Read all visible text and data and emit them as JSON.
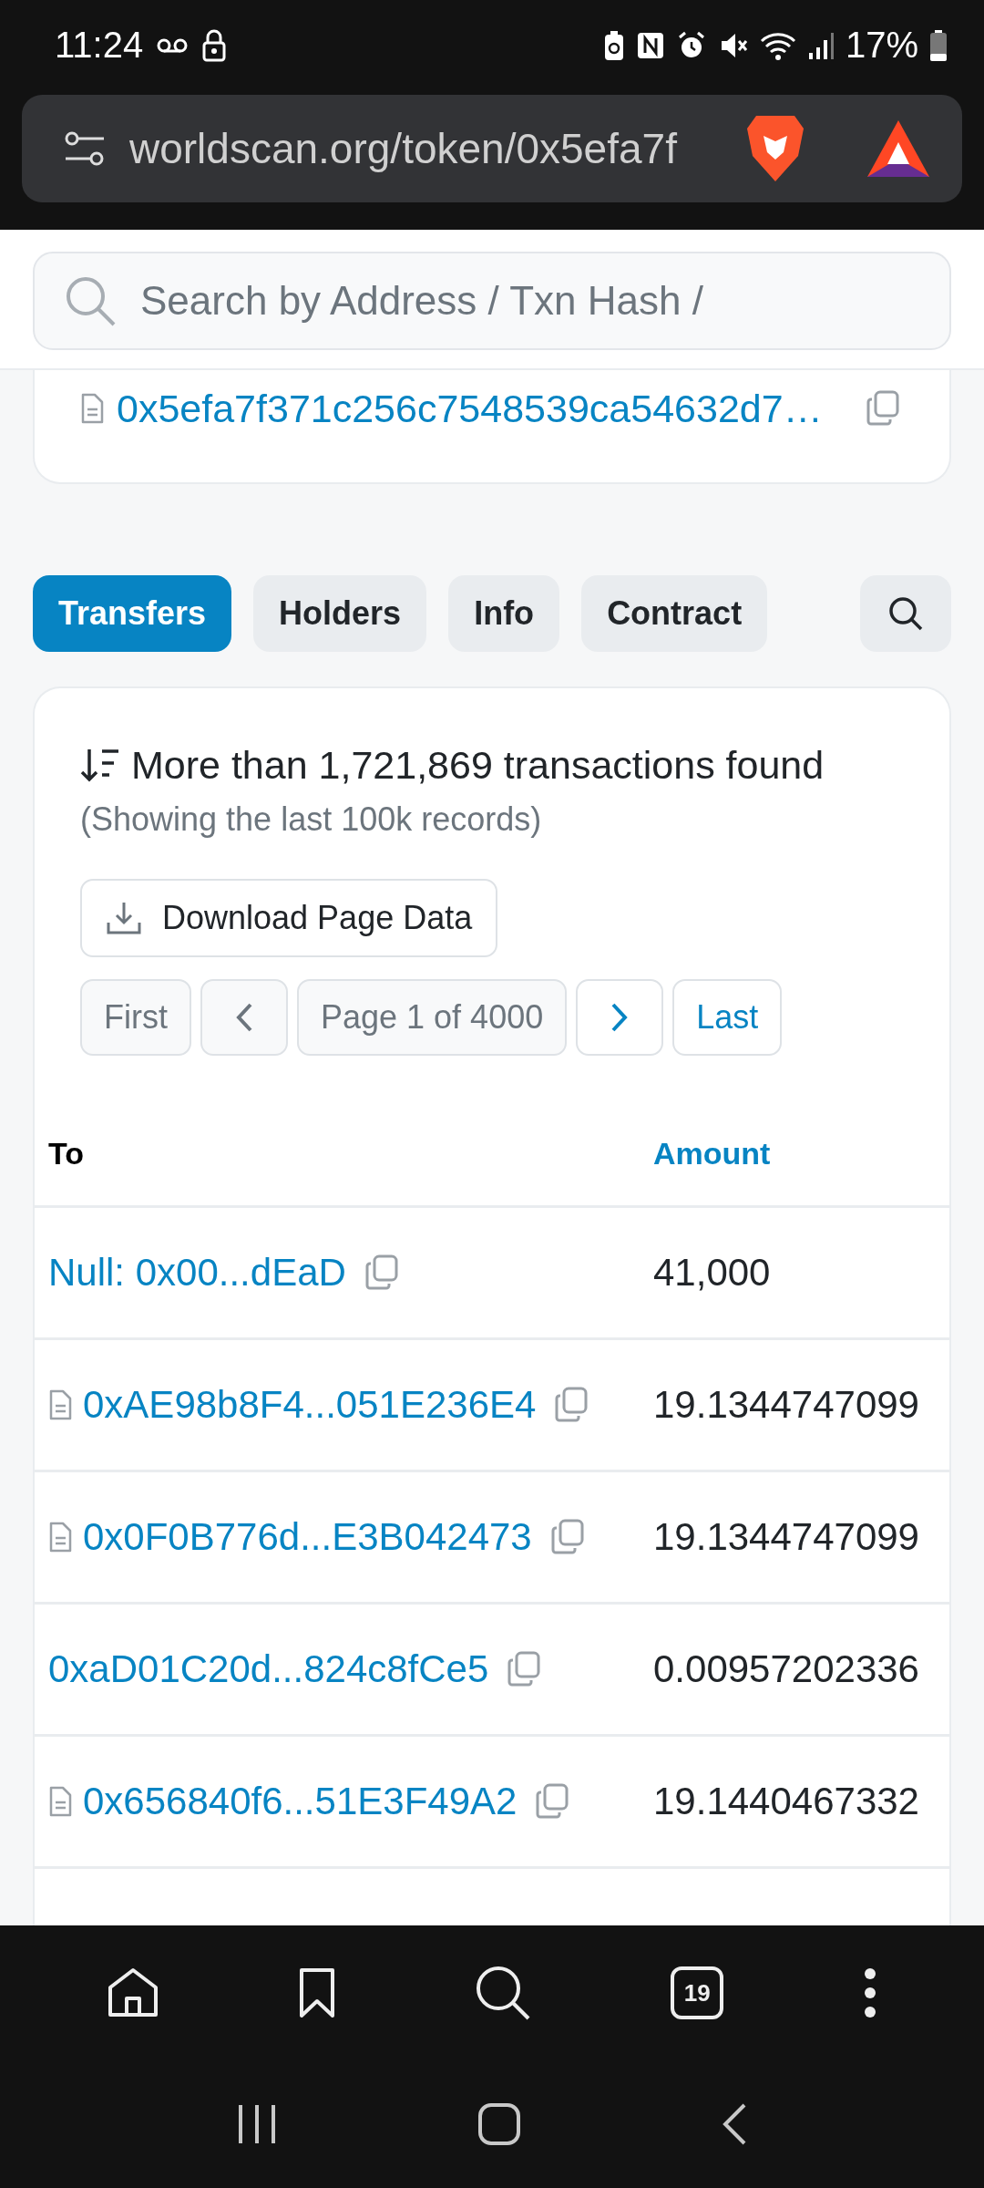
{
  "status_bar": {
    "time": "11:24",
    "battery": "17%"
  },
  "browser": {
    "url": "worldscan.org/token/0x5efa7f",
    "tab_count": "19"
  },
  "search": {
    "placeholder": "Search by Address / Txn Hash /"
  },
  "contract": {
    "address": "0x5efa7f371c256c7548539ca54632d7…"
  },
  "tabs": [
    {
      "label": "Transfers",
      "selected": true
    },
    {
      "label": "Holders",
      "selected": false
    },
    {
      "label": "Info",
      "selected": false
    },
    {
      "label": "Contract",
      "selected": false
    }
  ],
  "summary": {
    "title": "More than 1,721,869 transactions found",
    "note": "(Showing the last 100k records)"
  },
  "download_button": "Download Page Data",
  "pagination": [
    {
      "kind": "first",
      "label": "First",
      "disabled": true
    },
    {
      "kind": "prev",
      "disabled": true
    },
    {
      "kind": "page",
      "label": "Page 1 of 4000",
      "disabled": true
    },
    {
      "kind": "next",
      "disabled": false
    },
    {
      "kind": "last",
      "label": "Last",
      "disabled": false
    }
  ],
  "table": {
    "columns": [
      {
        "label": "To",
        "link": false
      },
      {
        "label": "Amount",
        "link": true
      }
    ],
    "rows": [
      {
        "to": "Null: 0x00...dEaD",
        "contract": false,
        "amount": "41,000"
      },
      {
        "to": "0xAE98b8F4...051E236E4",
        "contract": true,
        "amount": "19.1344747099"
      },
      {
        "to": "0x0F0B776d...E3B042473",
        "contract": true,
        "amount": "19.1344747099"
      },
      {
        "to": "0xaD01C20d...824c8fCe5",
        "contract": false,
        "amount": "0.00957202336"
      },
      {
        "to": "0x656840f6...51E3F49A2",
        "contract": true,
        "amount": "19.1440467332"
      }
    ]
  }
}
